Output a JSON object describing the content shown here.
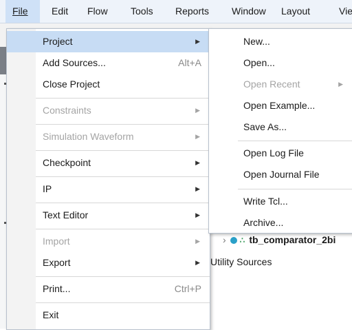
{
  "menubar": {
    "items": [
      {
        "label": "File"
      },
      {
        "label": "Edit"
      },
      {
        "label": "Flow"
      },
      {
        "label": "Tools"
      },
      {
        "label": "Reports"
      },
      {
        "label": "Window"
      },
      {
        "label": "Layout"
      },
      {
        "label": "Vie"
      }
    ]
  },
  "file_menu": {
    "items": [
      {
        "label": "Project",
        "submenu": true,
        "enabled": true,
        "highlighted": true
      },
      {
        "label": "Add Sources...",
        "shortcut": "Alt+A",
        "enabled": true
      },
      {
        "label": "Close Project",
        "enabled": true
      },
      {
        "label": "Constraints",
        "submenu": true,
        "enabled": false
      },
      {
        "label": "Simulation Waveform",
        "submenu": true,
        "enabled": false
      },
      {
        "label": "Checkpoint",
        "submenu": true,
        "enabled": true
      },
      {
        "label": "IP",
        "submenu": true,
        "enabled": true
      },
      {
        "label": "Text Editor",
        "submenu": true,
        "enabled": true
      },
      {
        "label": "Import",
        "submenu": true,
        "enabled": false
      },
      {
        "label": "Export",
        "submenu": true,
        "enabled": true
      },
      {
        "label": "Print...",
        "shortcut": "Ctrl+P",
        "enabled": true
      },
      {
        "label": "Exit",
        "enabled": true
      }
    ]
  },
  "project_submenu": {
    "items": [
      {
        "label": "New...",
        "enabled": true
      },
      {
        "label": "Open...",
        "enabled": true
      },
      {
        "label": "Open Recent",
        "submenu": true,
        "enabled": false
      },
      {
        "label": "Open Example...",
        "enabled": true
      },
      {
        "label": "Save As...",
        "enabled": true
      },
      {
        "label": "Open Log File",
        "enabled": true
      },
      {
        "label": "Open Journal File",
        "enabled": true
      },
      {
        "label": "Write Tcl...",
        "enabled": true
      },
      {
        "label": "Archive...",
        "enabled": true
      }
    ]
  },
  "background": {
    "tree_item": "tb_comparator_2bi",
    "utility_sources": "Utility Sources"
  },
  "icons": {
    "submenu_arrow": "▶",
    "tree_expand": "›",
    "tree_hierarchy": "∴"
  },
  "colors": {
    "menubar_bg": "#eef3fa",
    "highlight": "#c7dcf4",
    "disabled_text": "#a4a4a4"
  }
}
